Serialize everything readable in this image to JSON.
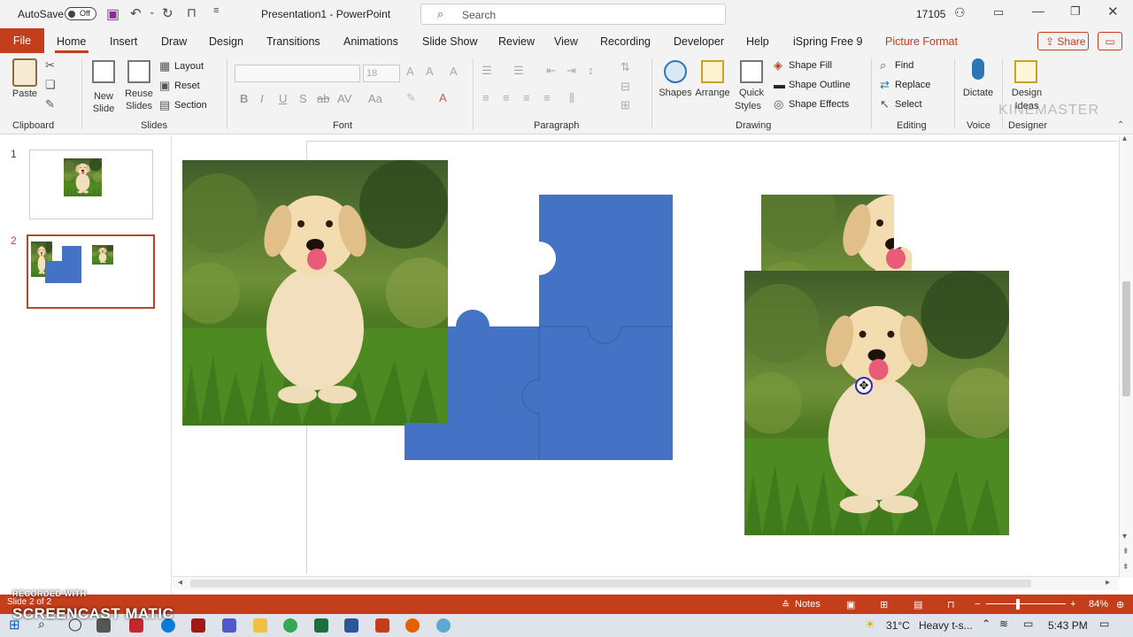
{
  "titlebar": {
    "autosave_label": "AutoSave",
    "autosave_state": "Off",
    "document_title": "Presentation1  -  PowerPoint",
    "search_placeholder": "Search",
    "user_number": "17105"
  },
  "tabs": [
    "File",
    "Home",
    "Insert",
    "Draw",
    "Design",
    "Transitions",
    "Animations",
    "Slide Show",
    "Review",
    "View",
    "Recording",
    "Developer",
    "Help",
    "iSpring Free 9",
    "Picture Format"
  ],
  "share_label": "Share",
  "ribbon": {
    "clipboard": {
      "paste": "Paste",
      "group": "Clipboard"
    },
    "slides": {
      "new_slide_1": "New",
      "new_slide_2": "Slide",
      "reuse_1": "Reuse",
      "reuse_2": "Slides",
      "layout": "Layout",
      "reset": "Reset",
      "section": "Section",
      "group": "Slides"
    },
    "font": {
      "size": "18",
      "group": "Font",
      "bold": "B",
      "italic": "I",
      "underline": "U",
      "shadow": "S",
      "strike": "ab",
      "spacing": "AV",
      "case": "Aa"
    },
    "paragraph": {
      "group": "Paragraph"
    },
    "drawing": {
      "shapes": "Shapes",
      "arrange": "Arrange",
      "quick_1": "Quick",
      "quick_2": "Styles",
      "shape_fill": "Shape Fill",
      "shape_outline": "Shape Outline",
      "shape_effects": "Shape Effects",
      "group": "Drawing"
    },
    "editing": {
      "find": "Find",
      "replace": "Replace",
      "select": "Select",
      "group": "Editing"
    },
    "voice": {
      "dictate": "Dictate",
      "group": "Voice"
    },
    "designer": {
      "design_1": "Design",
      "design_2": "Ideas",
      "group": "Designer"
    }
  },
  "watermark_top": "KINEMASTER",
  "thumbnails": [
    {
      "number": "1"
    },
    {
      "number": "2"
    }
  ],
  "status": {
    "slide_of": "Slide 2 of 2",
    "notes": "Notes",
    "zoom": "84%"
  },
  "recorder": {
    "small": "RECORDED WITH",
    "brand": "SCREENCAST  MATIC"
  },
  "taskbar": {
    "weather": "31°C",
    "weather_desc": "Heavy t-s...",
    "time": "5:43 PM"
  },
  "colors": {
    "accent": "#c43e1c",
    "puzzle": "#4472c4",
    "selected_thumb": "#b7472a"
  }
}
